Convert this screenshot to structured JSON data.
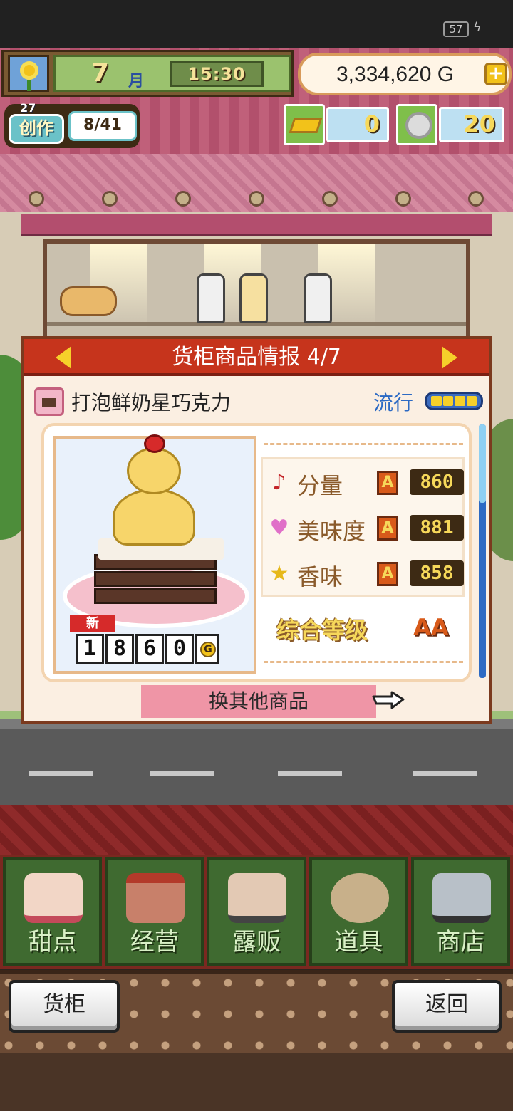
{
  "status_bar": {
    "battery": "57"
  },
  "hud": {
    "month": "7",
    "month_unit": "月",
    "time": "15:30",
    "money": "3,334,620 G",
    "create": {
      "label": "创作",
      "level": "27",
      "progress": "8/41"
    },
    "gold_bars": "0",
    "medals": "20"
  },
  "panel": {
    "title": "货柜商品情报 4/7",
    "item_name": "打泡鲜奶星巧克力",
    "trend_label": "流行",
    "trend_level": 4,
    "new_tag": "新",
    "price_digits": [
      "1",
      "8",
      "6",
      "0"
    ],
    "price_unit": "G",
    "stats": [
      {
        "icon": "music-note-icon",
        "glyph": "♪",
        "color": "#c4262a",
        "label": "分量",
        "grade": "A",
        "value": "860"
      },
      {
        "icon": "heart-icon",
        "glyph": "♥",
        "color": "#e070c8",
        "label": "美味度",
        "grade": "A",
        "value": "881"
      },
      {
        "icon": "star-icon",
        "glyph": "★",
        "color": "#e6b81a",
        "label": "香味",
        "grade": "A",
        "value": "858"
      }
    ],
    "overall_label": "综合等级",
    "overall_grade": "AA",
    "swap_label": "换其他商品"
  },
  "nav": [
    {
      "id": "dessert",
      "label": "甜点",
      "icon": "cake-icon",
      "color": "#f2d6c6"
    },
    {
      "id": "manage",
      "label": "经营",
      "icon": "shop-icon",
      "color": "#c8806a"
    },
    {
      "id": "street",
      "label": "露贩",
      "icon": "food-truck-icon",
      "color": "#e3c9b4"
    },
    {
      "id": "items",
      "label": "道具",
      "icon": "gear-bag-icon",
      "color": "#c8b08a"
    },
    {
      "id": "store",
      "label": "商店",
      "icon": "shopping-cart-icon",
      "color": "#b8c0c8"
    }
  ],
  "buttons": {
    "counter": "货柜",
    "back": "返回"
  }
}
